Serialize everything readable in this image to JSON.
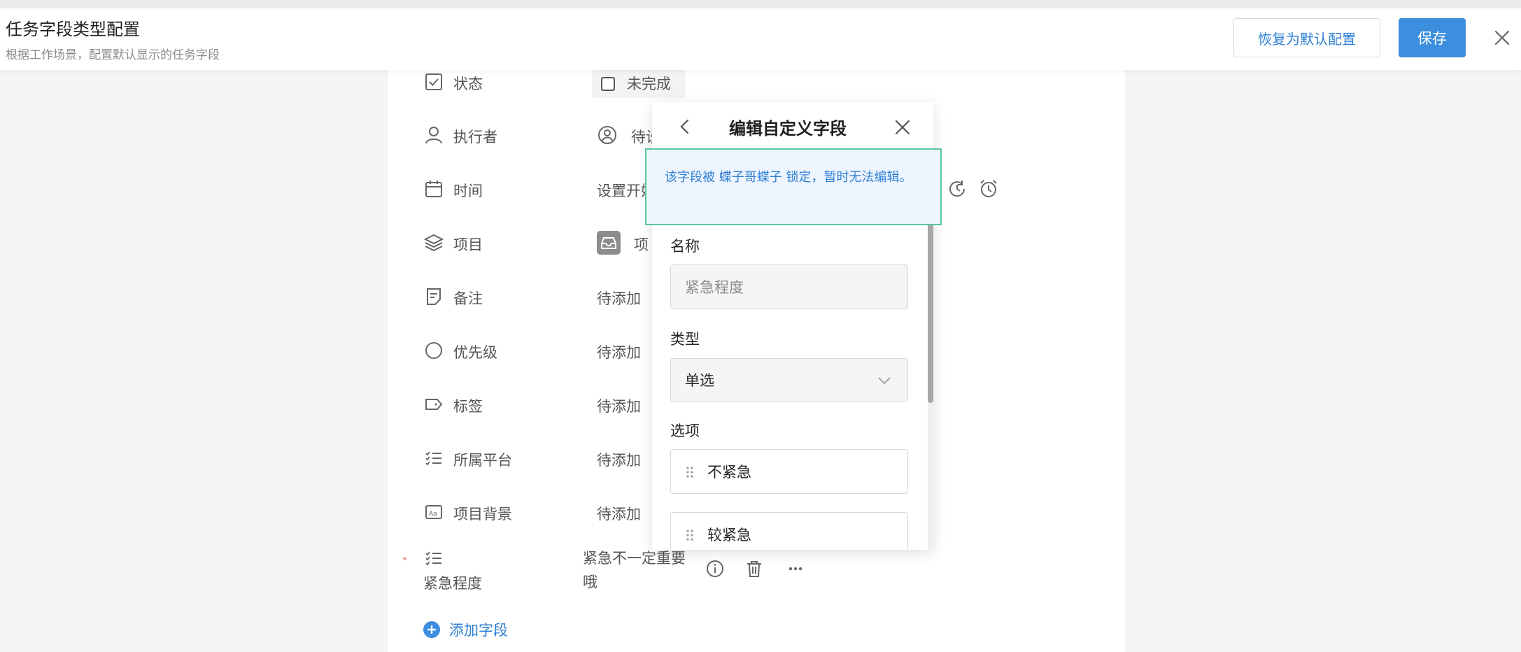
{
  "header": {
    "title": "任务字段类型配置",
    "subtitle": "根据工作场景，配置默认显示的任务字段",
    "reset_label": "恢复为默认配置",
    "save_label": "保存",
    "close_icon": "close-icon"
  },
  "fields": [
    {
      "label": "状态",
      "icon": "checkbox-icon",
      "value": "未完成"
    },
    {
      "label": "执行者",
      "icon": "user-icon",
      "value": "待设"
    },
    {
      "label": "时间",
      "icon": "calendar-icon",
      "value": "设置开始"
    },
    {
      "label": "项目",
      "icon": "layers-icon",
      "value": "项"
    },
    {
      "label": "备注",
      "icon": "note-icon",
      "value": "待添加"
    },
    {
      "label": "优先级",
      "icon": "circle-icon",
      "value": "待添加"
    },
    {
      "label": "标签",
      "icon": "tag-icon",
      "value": "待添加"
    },
    {
      "label": "所属平台",
      "icon": "list-icon",
      "value": "待添加"
    },
    {
      "label": "项目背景",
      "icon": "text-box-icon",
      "value": "待添加"
    },
    {
      "label": "紧急程度",
      "icon": "list-icon",
      "value_line1": "紧急不一定重要",
      "value_line2": "哦"
    }
  ],
  "add_field_label": "添加字段",
  "panel": {
    "title": "编辑自定义字段",
    "notice": "该字段被 蝶子哥蝶子 锁定，暂时无法编辑。",
    "name_label": "名称",
    "name_value": "紧急程度",
    "type_label": "类型",
    "type_value": "单选",
    "options_label": "选项",
    "options": [
      "不紧急",
      "较紧急"
    ]
  },
  "colors": {
    "accent": "#3c8ede",
    "link": "#2f7fd3",
    "notice_border": "#5cc79f",
    "notice_bg": "#eef5ff"
  }
}
